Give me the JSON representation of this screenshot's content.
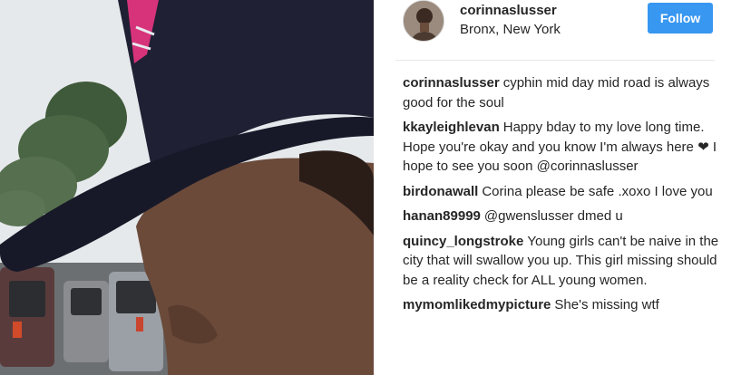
{
  "post": {
    "username": "corinnaslusser",
    "location": "Bronx, New York",
    "follow_label": "Follow"
  },
  "comments": [
    {
      "author": "corinnaslusser",
      "text": "cyphin mid day mid road is always good for the soul"
    },
    {
      "author": "kkayleighlevan",
      "text_before": "Happy bday to my love long time. Hope you're okay and you know I'm always here",
      "heart": "❤",
      "text_after": "I hope to see you soon @corinnaslusser"
    },
    {
      "author": "birdonawall",
      "text": "Corina please be safe .xoxo I love you"
    },
    {
      "author": "hanan89999",
      "text": "@gwenslusser dmed u"
    },
    {
      "author": "quincy_longstroke",
      "text": "Young girls can't be naive in the city that will swallow you up. This girl missing should be a reality check for ALL young women."
    },
    {
      "author": "mymomlikedmypicture",
      "text": "She's missing wtf"
    }
  ],
  "colors": {
    "follow_button": "#3897f0",
    "text": "#262626",
    "cap": "#1f2033",
    "cap_logo": "#d6337a"
  }
}
